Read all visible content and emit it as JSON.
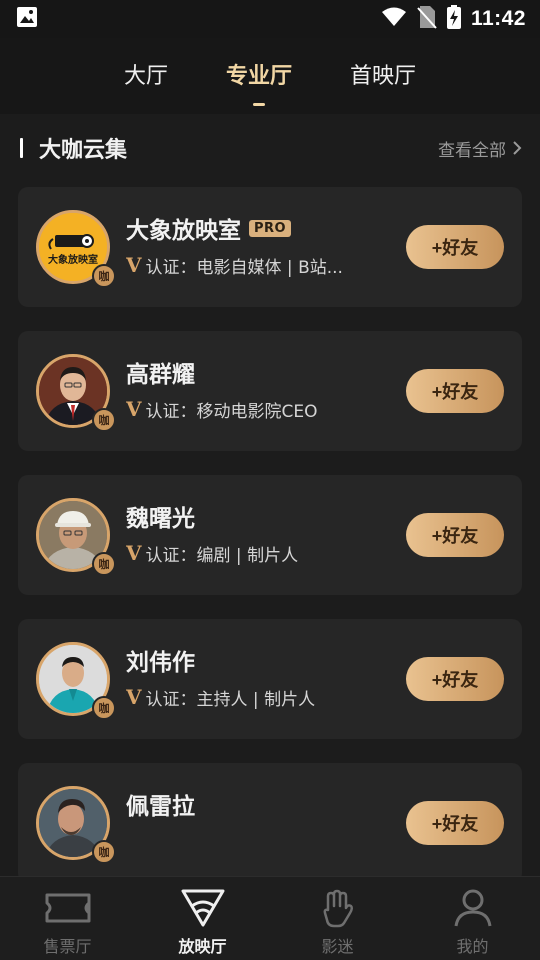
{
  "status_bar": {
    "time": "11:42"
  },
  "top_tabs": [
    {
      "label": "大厅",
      "active": false
    },
    {
      "label": "专业厅",
      "active": true
    },
    {
      "label": "首映厅",
      "active": false
    }
  ],
  "section": {
    "title": "大咖云集",
    "view_all": "查看全部"
  },
  "cards": [
    {
      "name": "大象放映室",
      "pro": "PRO",
      "cert": "认证：电影自媒体 | B站...",
      "button": "+好友",
      "badge": "咖",
      "avatar_text": "大象放映室"
    },
    {
      "name": "高群耀",
      "cert": "认证：移动电影院CEO",
      "button": "+好友",
      "badge": "咖"
    },
    {
      "name": "魏曙光",
      "cert": "认证：编剧 | 制片人",
      "button": "+好友",
      "badge": "咖"
    },
    {
      "name": "刘伟作",
      "cert": "认证：主持人 | 制片人",
      "button": "+好友",
      "badge": "咖"
    },
    {
      "name": "佩雷拉",
      "cert": "",
      "button": "+好友",
      "badge": "咖"
    }
  ],
  "cert_mark": "V",
  "bottom_nav": [
    {
      "label": "售票厅",
      "icon": "ticket-icon",
      "active": false
    },
    {
      "label": "放映厅",
      "icon": "projector-icon",
      "active": true
    },
    {
      "label": "影迷",
      "icon": "hand-gesture-icon",
      "active": false
    },
    {
      "label": "我的",
      "icon": "person-icon",
      "active": false
    }
  ],
  "colors": {
    "accent_gold": "#d8a56a",
    "background": "#161616",
    "card": "#262626"
  }
}
